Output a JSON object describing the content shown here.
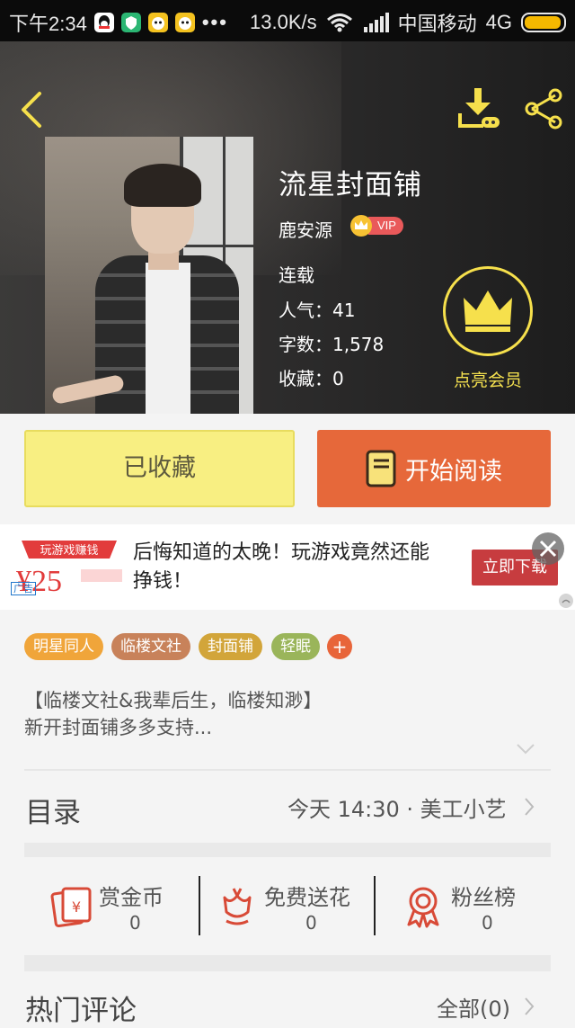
{
  "status_bar": {
    "time": "下午2:34",
    "dots": "•••",
    "speed": "13.0K/s",
    "carrier": "中国移动",
    "network": "4G"
  },
  "header": {
    "back_icon": "back-arrow-icon",
    "download_icon": "download-icon",
    "share_icon": "share-icon"
  },
  "book": {
    "title": "流星封面铺",
    "author": "鹿安源",
    "vip_badge": "VIP",
    "status": "连载",
    "popularity": "人气：41",
    "word_count": "字数：1,578",
    "favorites": "收藏：0"
  },
  "member": {
    "label": "点亮会员"
  },
  "actions": {
    "collected_label": "已收藏",
    "read_label": "开始阅读"
  },
  "ad": {
    "badge": "广告",
    "image_text": "玩游戏赚钱",
    "image_amount": "¥25",
    "text": "后悔知道的太晚！玩游戏竟然还能挣钱！",
    "cta": "立即下载"
  },
  "tags": [
    {
      "label": "明星同人",
      "color": "#f0a53a"
    },
    {
      "label": "临楼文社",
      "color": "#c8825a"
    },
    {
      "label": "封面铺",
      "color": "#d2a53a"
    },
    {
      "label": "轻眠",
      "color": "#9ab55a"
    }
  ],
  "tag_add": "+",
  "description": {
    "line1": "【临楼文社&我辈后生，临楼知渺】",
    "line2": "新开封面铺多多支持..."
  },
  "catalog": {
    "title": "目录",
    "update": "今天 14:30 · 美工小艺"
  },
  "stats": [
    {
      "label": "赏金币",
      "value": "0",
      "icon": "red-envelope-icon"
    },
    {
      "label": "免费送花",
      "value": "0",
      "icon": "flower-icon"
    },
    {
      "label": "粉丝榜",
      "value": "0",
      "icon": "ribbon-medal-icon"
    }
  ],
  "comments": {
    "title": "热门评论",
    "all": "全部(0)"
  },
  "colors": {
    "accent_yellow": "#f6e04c",
    "read_orange": "#e6683a",
    "collected_yellow": "#f8ef82",
    "stat_icon_red": "#d84a37"
  }
}
